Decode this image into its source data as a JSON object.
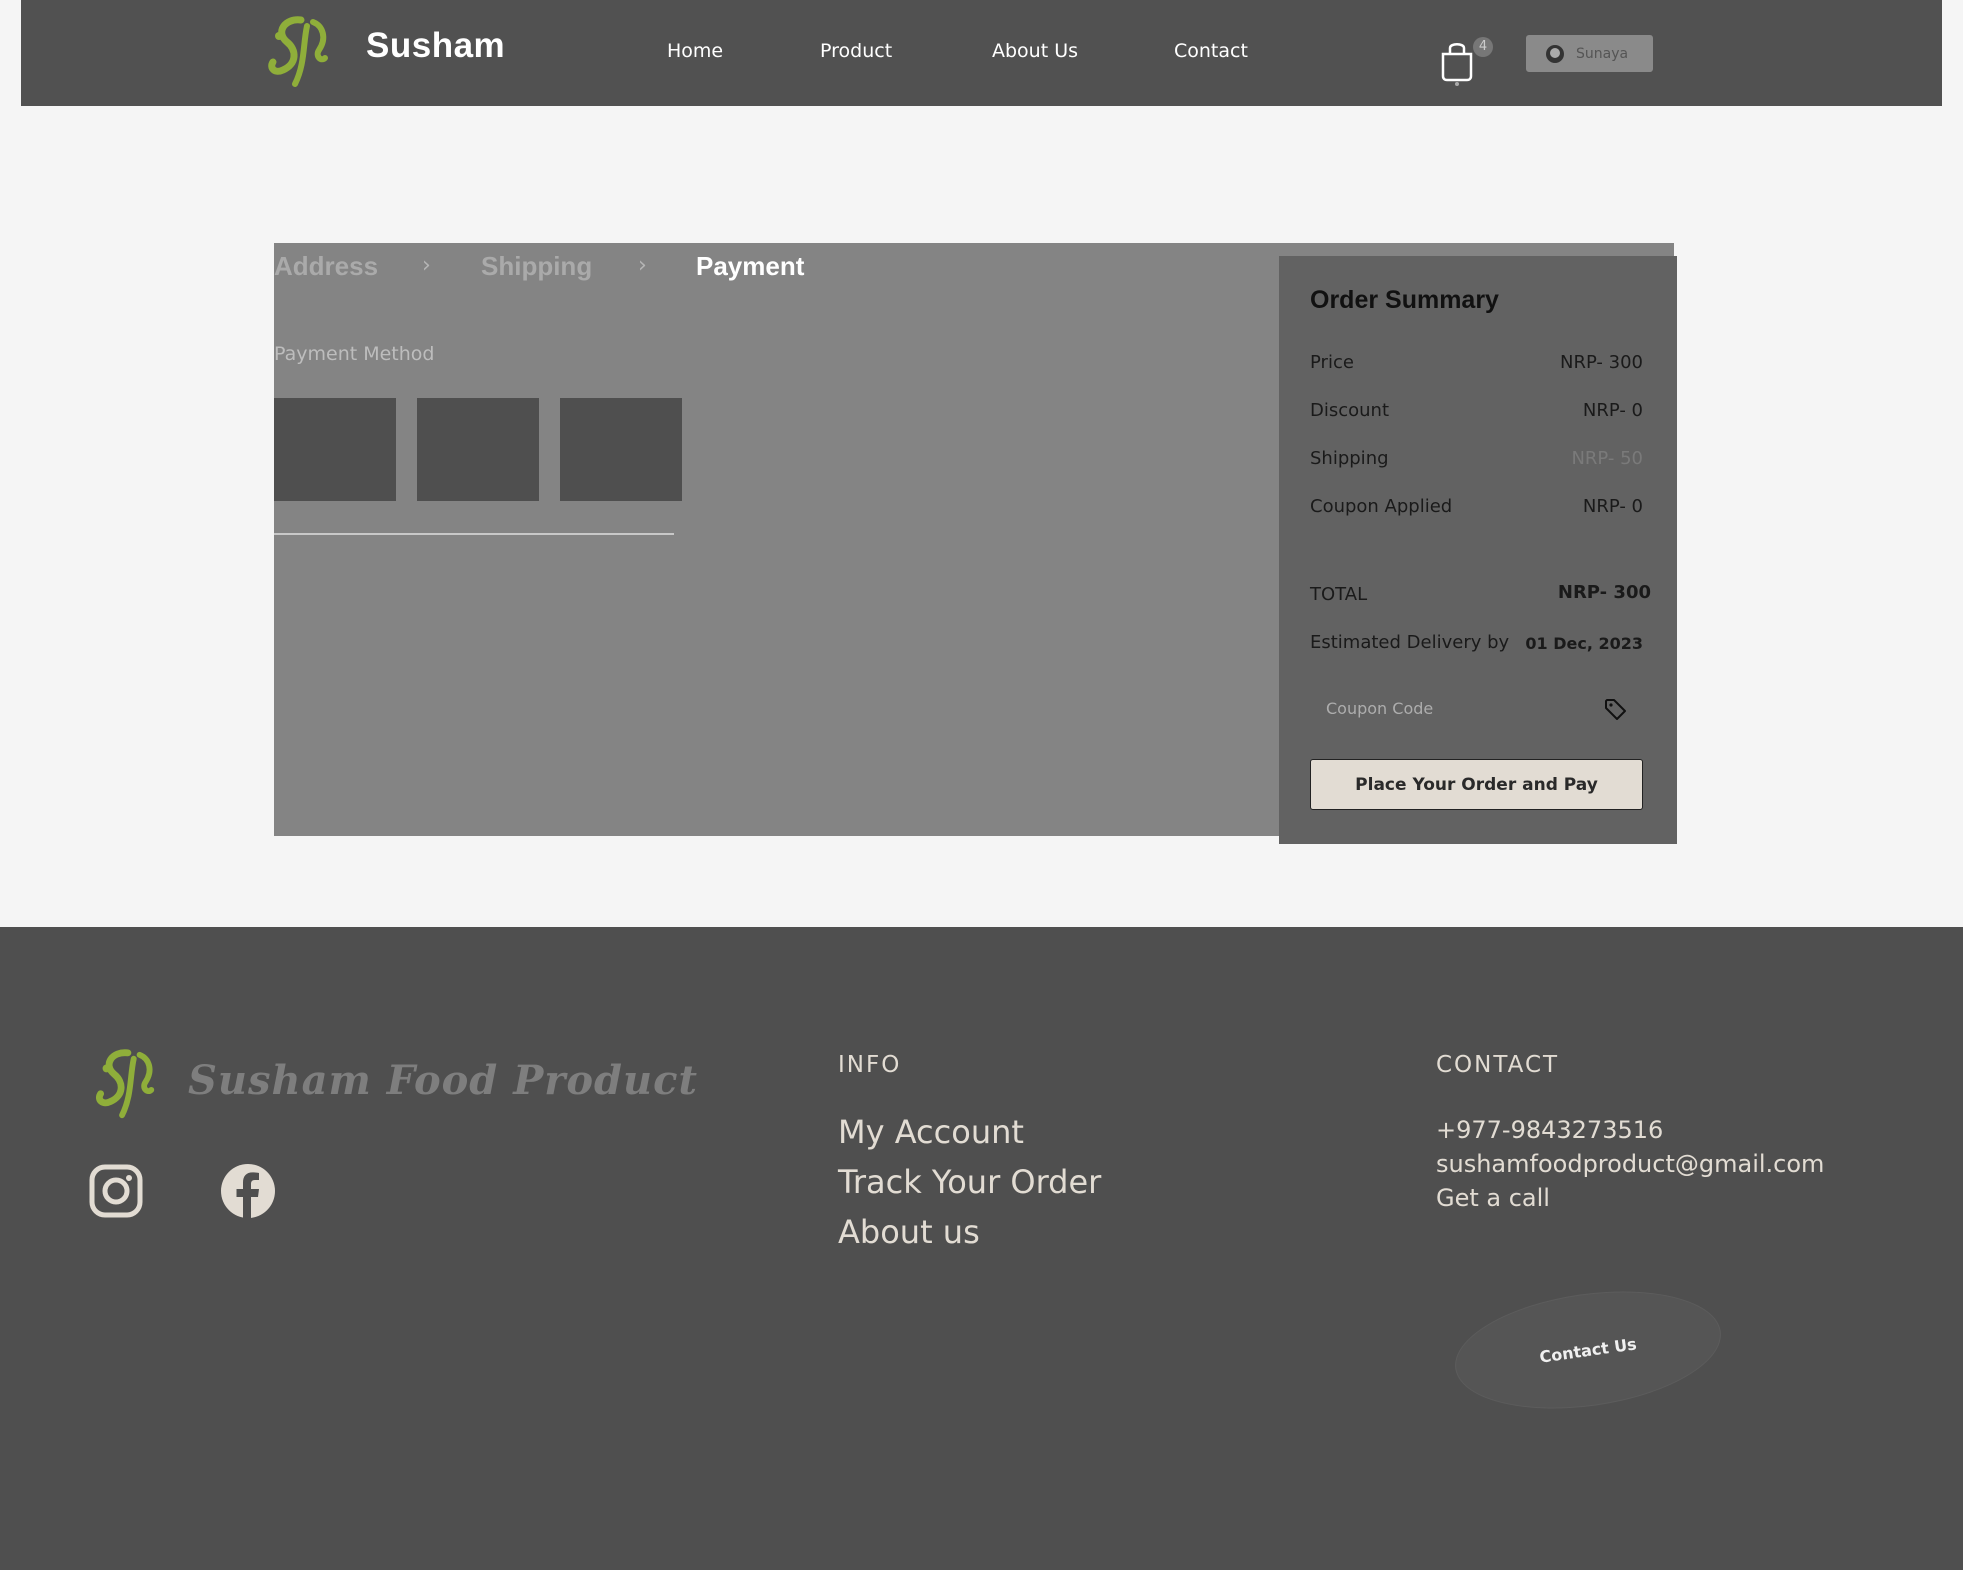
{
  "header": {
    "brand": "Susham",
    "nav": [
      "Home",
      "Product",
      "About Us",
      "Contact"
    ],
    "cart_count": "4",
    "user_name": "Sunaya"
  },
  "checkout": {
    "steps": [
      "Address",
      "Shipping",
      "Payment"
    ],
    "active_step": "Payment",
    "payment_method_label": "Payment Method"
  },
  "summary": {
    "title": "Order Summary",
    "rows": [
      {
        "label": "Price",
        "value": "NRP- 300"
      },
      {
        "label": "Discount",
        "value": "NRP- 0"
      },
      {
        "label": "Shipping",
        "value": "NRP- 50"
      },
      {
        "label": "Coupon Applied",
        "value": "NRP- 0"
      }
    ],
    "total_label": "TOTAL",
    "total_value": "NRP- 300",
    "eta_label": "Estimated Delivery by",
    "eta_value": "01 Dec, 2023",
    "coupon_placeholder": "Coupon Code",
    "pay_button": "Place Your Order and Pay"
  },
  "footer": {
    "brand_script": "Susham Food Product",
    "info_heading": "INFO",
    "info_links": [
      "My Account",
      "Track Your Order",
      "About us"
    ],
    "contact_heading": "CONTACT",
    "phone": "+977-9843273516",
    "email": "sushamfoodproduct@gmail.com",
    "call": "Get a call",
    "contact_button": "Contact Us"
  },
  "colors": {
    "brand_green": "#8fae3a",
    "header_bg": "#515151",
    "footer_bg": "#4f4f4f",
    "accent_cream": "#e2dcd3"
  }
}
